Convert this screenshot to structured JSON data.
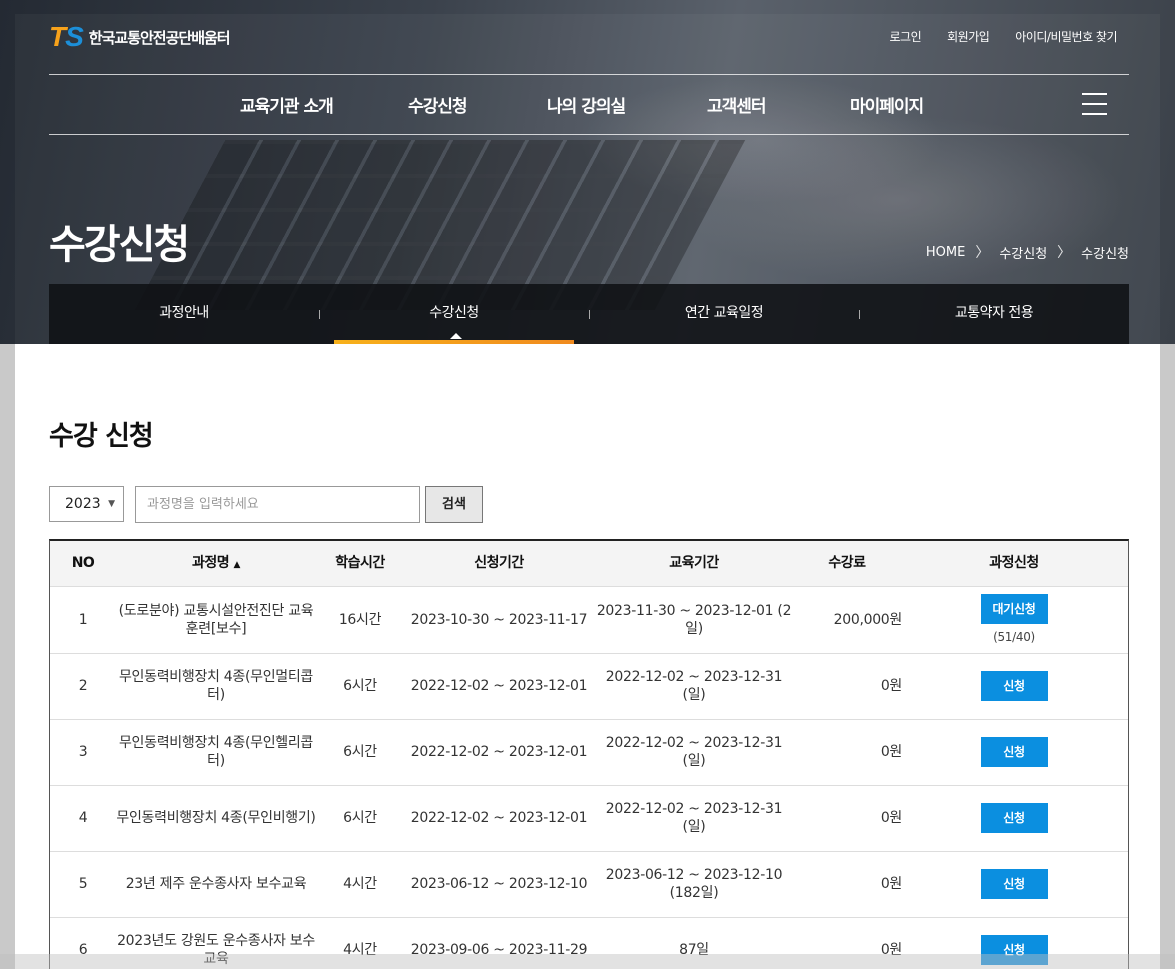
{
  "brand": {
    "logo_t": "T",
    "logo_s": "S",
    "name": "한국교통안전공단배움터"
  },
  "util_links": [
    "로그인",
    "회원가입",
    "아이디/비밀번호 찾기"
  ],
  "gnb": [
    "교육기관 소개",
    "수강신청",
    "나의 강의실",
    "고객센터",
    "마이페이지"
  ],
  "hero": {
    "title": "수강신청"
  },
  "breadcrumb": {
    "home": "HOME",
    "level1": "수강신청",
    "level2": "수강신청"
  },
  "subnav": [
    "과정안내",
    "수강신청",
    "연간 교육일정",
    "교통약자 전용"
  ],
  "section_title": "수강 신청",
  "search": {
    "year": "2023",
    "placeholder": "과정명을 입력하세요",
    "button": "검색"
  },
  "table": {
    "headers": {
      "no": "NO",
      "course": "과정명",
      "sort_mark": "▲",
      "hours": "학습시간",
      "apply_period": "신청기간",
      "edu_period": "교육기간",
      "fee": "수강료",
      "action": "과정신청"
    },
    "rows": [
      {
        "no": "1",
        "course": "(도로분야) 교통시설안전진단 교육 훈련[보수]",
        "hours": "16시간",
        "apply": "2023-10-30 ~ 2023-11-17",
        "edu": "2023-11-30 ~ 2023-12-01 (2일)",
        "fee": "200,000원",
        "button": "대기신청",
        "seats": "(51/40)"
      },
      {
        "no": "2",
        "course": "무인동력비행장치 4종(무인멀티콥터)",
        "hours": "6시간",
        "apply": "2022-12-02 ~ 2023-12-01",
        "edu": "2022-12-02 ~ 2023-12-31 (일)",
        "fee": "0원",
        "button": "신청",
        "seats": ""
      },
      {
        "no": "3",
        "course": "무인동력비행장치 4종(무인헬리콥터)",
        "hours": "6시간",
        "apply": "2022-12-02 ~ 2023-12-01",
        "edu": "2022-12-02 ~ 2023-12-31 (일)",
        "fee": "0원",
        "button": "신청",
        "seats": ""
      },
      {
        "no": "4",
        "course": "무인동력비행장치 4종(무인비행기)",
        "hours": "6시간",
        "apply": "2022-12-02 ~ 2023-12-01",
        "edu": "2022-12-02 ~ 2023-12-31 (일)",
        "fee": "0원",
        "button": "신청",
        "seats": ""
      },
      {
        "no": "5",
        "course": "23년 제주 운수종사자 보수교육",
        "hours": "4시간",
        "apply": "2023-06-12 ~ 2023-12-10",
        "edu": "2023-06-12 ~ 2023-12-10 (182일)",
        "fee": "0원",
        "button": "신청",
        "seats": ""
      },
      {
        "no": "6",
        "course": "2023년도 강원도 운수종사자 보수교육",
        "hours": "4시간",
        "apply": "2023-09-06 ~ 2023-11-29",
        "edu": "87일",
        "fee": "0원",
        "button": "신청",
        "seats": ""
      }
    ]
  },
  "colors": {
    "accent_blue": "#0b8fe0",
    "accent_orange": "#f7a21b",
    "bar_gradient_start": "#f7b11b",
    "bar_gradient_end": "#f08a1e"
  }
}
